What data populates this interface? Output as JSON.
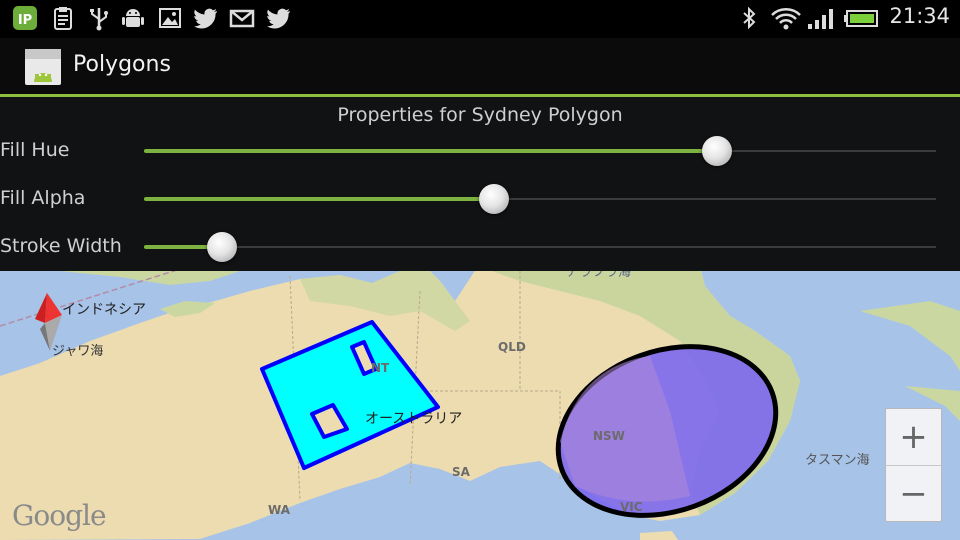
{
  "status_bar": {
    "time": "21:34",
    "left_icons": [
      "app-ip-icon",
      "clipboard-icon",
      "usb-icon",
      "android-debug-icon",
      "image-icon",
      "twitter-icon",
      "gmail-icon",
      "twitter-icon"
    ],
    "right_icons": [
      "bluetooth-icon",
      "wifi-icon",
      "signal-icon",
      "battery-icon"
    ]
  },
  "action_bar": {
    "title": "Polygons",
    "accent_color": "#8fbf3f"
  },
  "panel": {
    "title": "Properties for Sydney Polygon",
    "sliders": [
      {
        "label": "Fill Hue",
        "value": 0.723
      },
      {
        "label": "Fill Alpha",
        "value": 0.442
      },
      {
        "label": "Stroke Width",
        "value": 0.098
      }
    ]
  },
  "map": {
    "labels": {
      "indonesia": "インドネシア",
      "java_sea": "ジャワ海",
      "arafura_sea": "アラフラ海",
      "nt": "NT",
      "qld": "QLD",
      "australia": "オーストラリア",
      "sa": "SA",
      "wa": "WA",
      "nsw": "NSW",
      "vic": "VIC",
      "tasman_sea": "タスマン海"
    },
    "polygons": [
      {
        "name": "australia-rectangle",
        "fill": "#00ffff",
        "stroke": "#0000ff"
      },
      {
        "name": "sydney-polygon",
        "fill": "#7b68ee",
        "stroke": "#000000"
      }
    ],
    "google_logo": "Google",
    "zoom_in": "+",
    "zoom_out": "−"
  }
}
